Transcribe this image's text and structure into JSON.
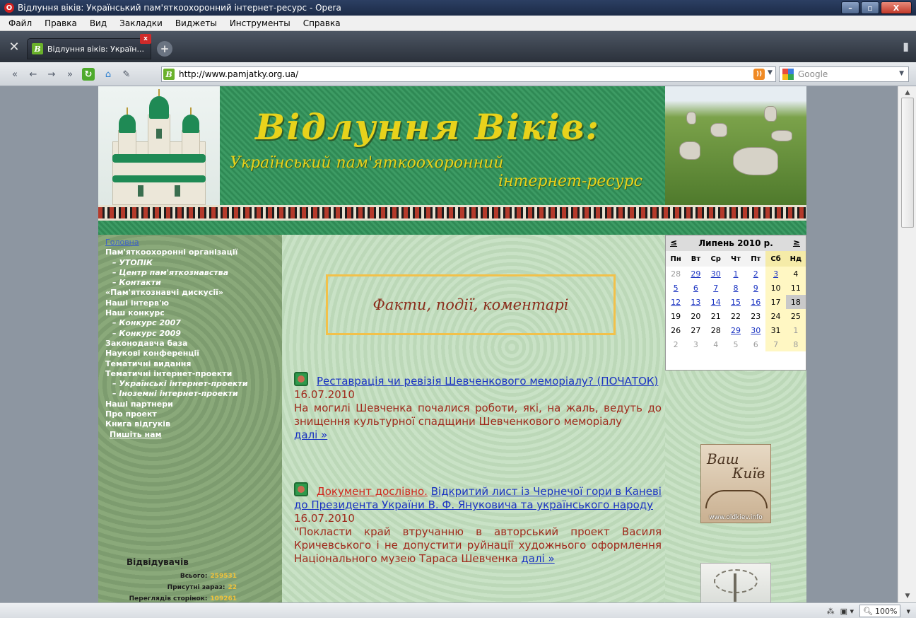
{
  "window": {
    "title": "Відлуння віків: Український пам'яткоохоронний інтернет-ресурс - Opera",
    "controls": {
      "minimize": "–",
      "maximize": "▫",
      "close": "X"
    }
  },
  "menu": [
    "Файл",
    "Правка",
    "Вид",
    "Закладки",
    "Виджеты",
    "Инструменты",
    "Справка"
  ],
  "tab": {
    "label": "Відлуння віків: Україн...",
    "close": "x",
    "new_tab": "+"
  },
  "toolbar": {
    "url": "http://www.pamjatky.org.ua/",
    "search_placeholder": "Google",
    "rss": "RSS"
  },
  "status": {
    "zoom": "100%"
  },
  "site": {
    "title": "Відлуння Віків:",
    "subtitle_1": "Український пам'яткоохоронний",
    "subtitle_2": "інтернет-ресурс",
    "menu": [
      {
        "label": "Головна",
        "type": "link"
      },
      {
        "label": "Пам'яткоохоронні організації",
        "type": "item"
      },
      {
        "label": "– УТОПІК",
        "type": "sub"
      },
      {
        "label": "– Центр пам'яткознавства",
        "type": "sub"
      },
      {
        "label": "– Контакти",
        "type": "sub"
      },
      {
        "label": "«Пам'яткознавчі дискусії»",
        "type": "item"
      },
      {
        "label": "Наші інтерв'ю",
        "type": "item"
      },
      {
        "label": "Наш конкурс",
        "type": "item"
      },
      {
        "label": "– Конкурс 2007",
        "type": "sub"
      },
      {
        "label": "– Конкурс 2009",
        "type": "sub"
      },
      {
        "label": "Законодавча база",
        "type": "item"
      },
      {
        "label": "Наукові конференції",
        "type": "item"
      },
      {
        "label": "Тематичні видання",
        "type": "item"
      },
      {
        "label": "Тематичні інтернет-проекти",
        "type": "item"
      },
      {
        "label": "– Українські інтернет-проекти",
        "type": "sub"
      },
      {
        "label": "– Іноземні інтернет-проекти",
        "type": "sub"
      },
      {
        "label": "Наші партнери",
        "type": "item"
      },
      {
        "label": "Про проект",
        "type": "item"
      },
      {
        "label": "Книга відгуків",
        "type": "item"
      },
      {
        "label": "Пишіть нам",
        "type": "write"
      }
    ],
    "visitors": {
      "title": "Відвідувачів",
      "total_label": "Всього:",
      "total_value": "259531",
      "online_label": "Присутні зараз:",
      "online_value": "22",
      "views_label": "Переглядів сторінок:",
      "views_value": "109261"
    },
    "facts_heading": "Факти, події, коментарі",
    "articles": [
      {
        "title": "Реставрація чи ревізія Шевченкового меморіалу? (ПОЧАТОК)",
        "date": "16.07.2010",
        "text": "На могилі Шевченка почалися роботи, які, на жаль, ведуть до знищення культурної спадщини Шевченкового меморіалу",
        "more": "далі »"
      },
      {
        "prefix": "Документ дослівно.",
        "title": "Відкритий лист із Чернечої гори в Каневі до Президента України В. Ф. Януковича та українського народу",
        "date": "16.07.2010",
        "text": "\"Покласти край втручанню в авторський проект Василя Кричевського і не допустити руйнації художнього оформлення Національного музею Тараса Шевченка",
        "more": "далі »"
      }
    ],
    "calendar": {
      "prev": "≤",
      "next": "≥",
      "month": "Липень 2010 р.",
      "weekdays": [
        "Пн",
        "Вт",
        "Ср",
        "Чт",
        "Пт",
        "Сб",
        "Нд"
      ],
      "weeks": [
        [
          "28",
          "29",
          "30",
          "1",
          "2",
          "3",
          "4"
        ],
        [
          "5",
          "6",
          "7",
          "8",
          "9",
          "10",
          "11"
        ],
        [
          "12",
          "13",
          "14",
          "15",
          "16",
          "17",
          "18"
        ],
        [
          "19",
          "20",
          "21",
          "22",
          "23",
          "24",
          "25"
        ],
        [
          "26",
          "27",
          "28",
          "29",
          "30",
          "31",
          "1"
        ],
        [
          "2",
          "3",
          "4",
          "5",
          "6",
          "7",
          "8"
        ]
      ],
      "linked_days": [
        "29",
        "30",
        "1",
        "2",
        "3",
        "5",
        "6",
        "7",
        "8",
        "9",
        "12",
        "13",
        "14",
        "15",
        "16"
      ],
      "today": "18"
    },
    "banners": {
      "kiev_line1": "Ваш",
      "kiev_line2": "Київ",
      "kiev_url": "www.oldkiev.info"
    }
  }
}
